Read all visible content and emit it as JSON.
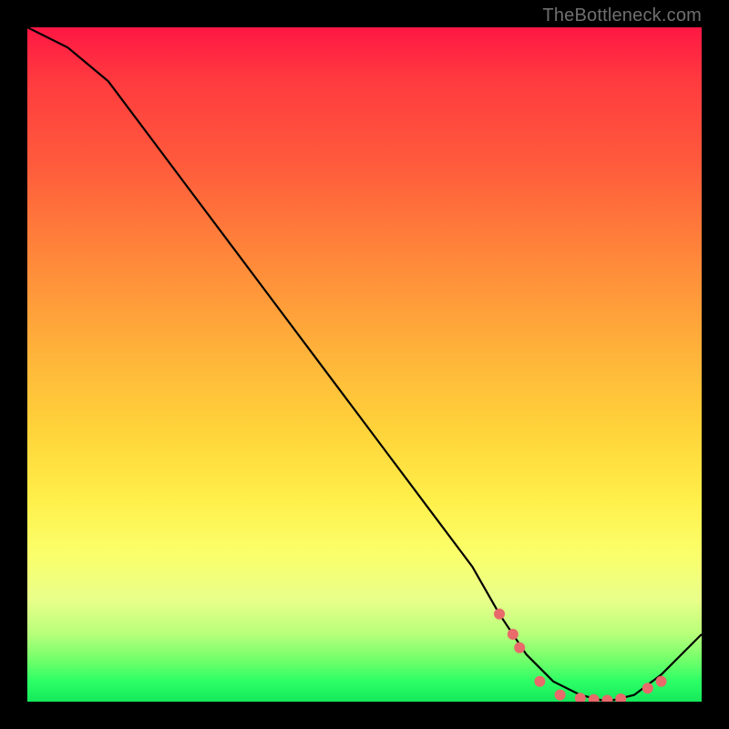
{
  "watermark": "TheBottleneck.com",
  "colors": {
    "frame": "#000000",
    "gradient_top": "#ff1744",
    "gradient_mid": "#ffd43a",
    "gradient_bottom": "#14e85a",
    "curve": "#000000",
    "markers": "#e86a6a"
  },
  "chart_data": {
    "type": "line",
    "title": "",
    "xlabel": "",
    "ylabel": "",
    "xlim": [
      0,
      100
    ],
    "ylim": [
      0,
      100
    ],
    "grid": false,
    "legend": false,
    "x": [
      0,
      6,
      12,
      18,
      24,
      30,
      36,
      42,
      48,
      54,
      60,
      66,
      70,
      74,
      78,
      82,
      86,
      90,
      94,
      100
    ],
    "values": [
      100,
      97,
      92,
      84,
      76,
      68,
      60,
      52,
      44,
      36,
      28,
      20,
      13,
      7,
      3,
      1,
      0,
      1,
      4,
      10
    ],
    "markers": {
      "x": [
        70,
        72,
        73,
        76,
        79,
        82,
        84,
        86,
        88,
        92,
        94
      ],
      "y": [
        13,
        10,
        8,
        3,
        1,
        0.5,
        0.3,
        0.2,
        0.4,
        2,
        3
      ]
    },
    "annotations": []
  }
}
